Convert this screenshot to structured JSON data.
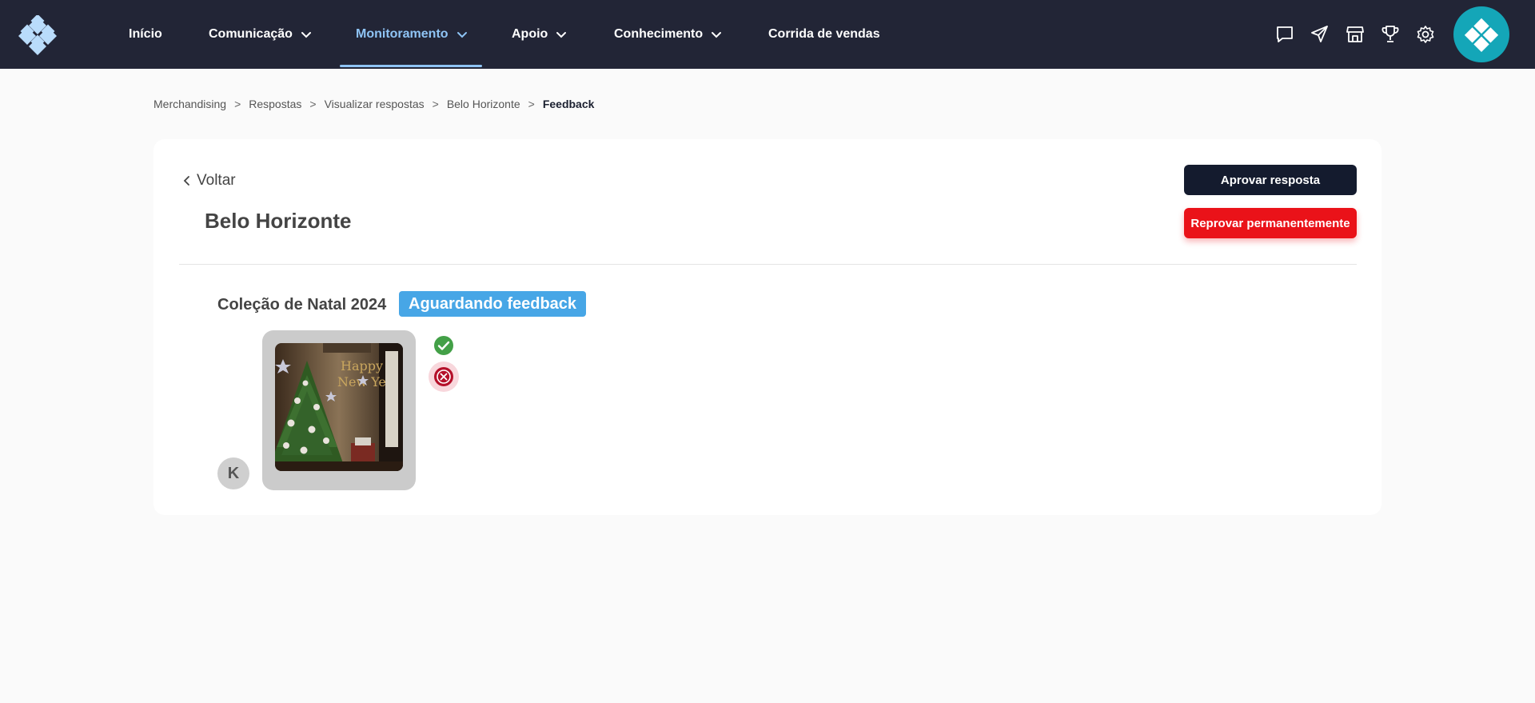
{
  "nav": {
    "items": [
      {
        "label": "Início",
        "has_dropdown": false,
        "active": false
      },
      {
        "label": "Comunicação",
        "has_dropdown": true,
        "active": false
      },
      {
        "label": "Monitoramento",
        "has_dropdown": true,
        "active": true
      },
      {
        "label": "Apoio",
        "has_dropdown": true,
        "active": false
      },
      {
        "label": "Conhecimento",
        "has_dropdown": true,
        "active": false
      },
      {
        "label": "Corrida de vendas",
        "has_dropdown": false,
        "active": false
      }
    ],
    "icons": [
      "chat-icon",
      "send-icon",
      "store-icon",
      "trophy-icon",
      "gear-icon"
    ],
    "colors": {
      "background": "#222536",
      "active": "#8fc4f5",
      "avatar": "#14a6b8"
    }
  },
  "breadcrumb": {
    "items": [
      "Merchandising",
      "Respostas",
      "Visualizar respostas",
      "Belo Horizonte"
    ],
    "current": "Feedback",
    "separator": ">"
  },
  "card": {
    "back_label": "Voltar",
    "title": "Belo Horizonte",
    "approve_label": "Aprovar resposta",
    "reject_label": "Reprovar permanentemente",
    "section_title": "Coleção de Natal 2024",
    "status_badge": "Aguardando feedback",
    "user_initial": "K",
    "colors": {
      "approve": "#141b2e",
      "reject": "#ea1219",
      "badge": "#47a6e6",
      "check": "#43a047",
      "cross": "#b5102a"
    }
  }
}
